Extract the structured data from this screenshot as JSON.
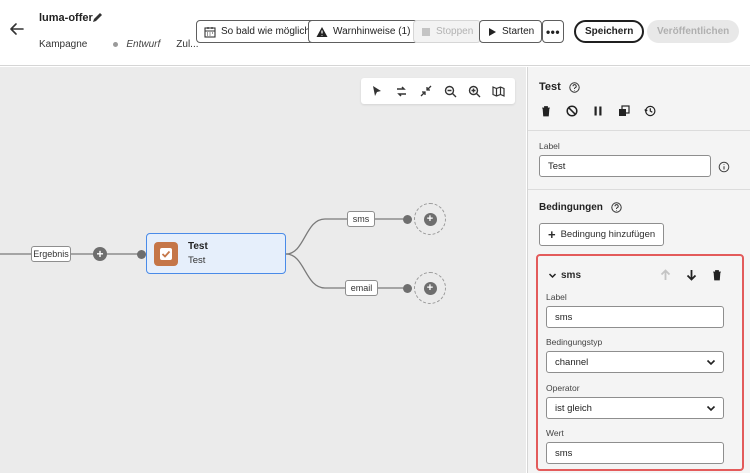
{
  "header": {
    "title": "luma-offer",
    "meta_type": "Kampagne",
    "meta_status": "Entwurf",
    "meta_more": "Zul...",
    "buttons": {
      "schedule": "So bald wie möglich",
      "warnings": "Warnhinweise (1)",
      "stop": "Stoppen",
      "start": "Starten",
      "save": "Speichern",
      "publish": "Veröffentlichen"
    }
  },
  "canvas": {
    "result_label": "Ergebnis",
    "node": {
      "title": "Test",
      "subtitle": "Test"
    },
    "branches": [
      "sms",
      "email"
    ]
  },
  "panel": {
    "title": "Test",
    "label_caption": "Label",
    "label_value": "Test",
    "conditions_title": "Bedingungen",
    "add_condition": "Bedingung hinzufügen",
    "condition": {
      "name": "sms",
      "label_caption": "Label",
      "label_value": "sms",
      "type_caption": "Bedingungstyp",
      "type_value": "channel",
      "operator_caption": "Operator",
      "operator_value": "ist gleich",
      "value_caption": "Wert",
      "value_value": "sms"
    }
  },
  "colors": {
    "accent_blue": "#4a8be8",
    "node_icon": "#c57648",
    "highlight_red": "#e35b5b"
  }
}
